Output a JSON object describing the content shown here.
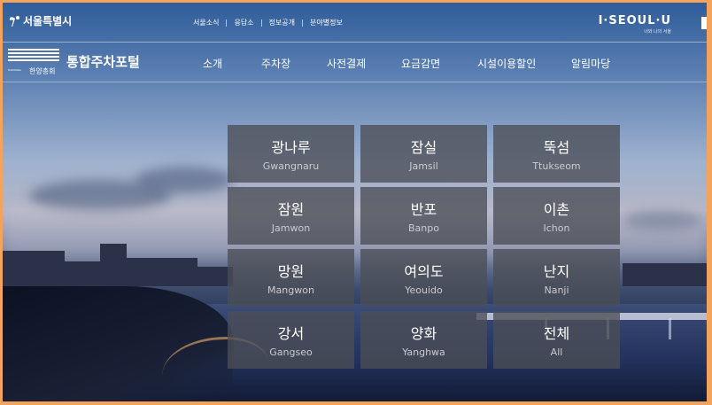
{
  "topbar": {
    "seoul_name": "서울특별시",
    "util_links": [
      "서울소식",
      "응답소",
      "정보공개",
      "분야별정보"
    ],
    "brand_main": "I·SEOUL·U",
    "brand_sub": "너와 나의 서울"
  },
  "header": {
    "logo_en": "HANYANG",
    "logo_ko": "한양총회",
    "title": "통합주차포털",
    "gnb": [
      "소개",
      "주차장",
      "사전결제",
      "요금감면",
      "시설이용할인",
      "알림마당"
    ]
  },
  "parks": [
    {
      "ko": "광나루",
      "en": "Gwangnaru"
    },
    {
      "ko": "잠실",
      "en": "Jamsil"
    },
    {
      "ko": "뚝섬",
      "en": "Ttukseom"
    },
    {
      "ko": "잠원",
      "en": "Jamwon"
    },
    {
      "ko": "반포",
      "en": "Banpo"
    },
    {
      "ko": "이촌",
      "en": "Ichon"
    },
    {
      "ko": "망원",
      "en": "Mangwon"
    },
    {
      "ko": "여의도",
      "en": "Yeouido"
    },
    {
      "ko": "난지",
      "en": "Nanji"
    },
    {
      "ko": "강서",
      "en": "Gangseo"
    },
    {
      "ko": "양화",
      "en": "Yanghwa"
    },
    {
      "ko": "전체",
      "en": "All"
    }
  ]
}
